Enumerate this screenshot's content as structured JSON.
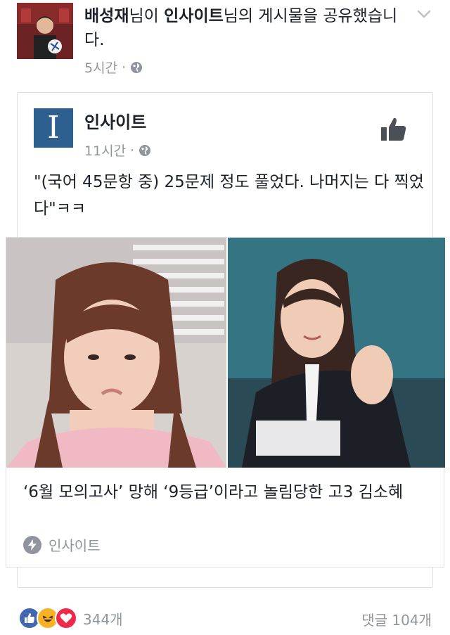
{
  "header": {
    "sharer_name": "배성재",
    "share_part1": "님이 ",
    "page_name": "인사이트",
    "share_part2": "님의 게시물을 공유했습니다.",
    "time": "5시간",
    "dot": "·"
  },
  "post": {
    "page_name": "인사이트",
    "logo_letter": "I",
    "time": "11시간",
    "dot": "·",
    "text": "\"(국어 45문항 중) 25문제 정도 풀었다. 나머지는 다 찍었다\"ㅋㅋ",
    "logo_color": "#2d5f8f"
  },
  "link": {
    "title": "‘6월 모의고사’ 망해 ‘9등급’이라고 놀림당한 고3 김소혜",
    "source": "인사이트"
  },
  "footer": {
    "reaction_count": "344개",
    "comment_count": "댓글 104개"
  },
  "colors": {
    "accent": "#4267b2",
    "meta_text": "#90949c",
    "love": "#f0284a",
    "haha": "#f7b125"
  }
}
